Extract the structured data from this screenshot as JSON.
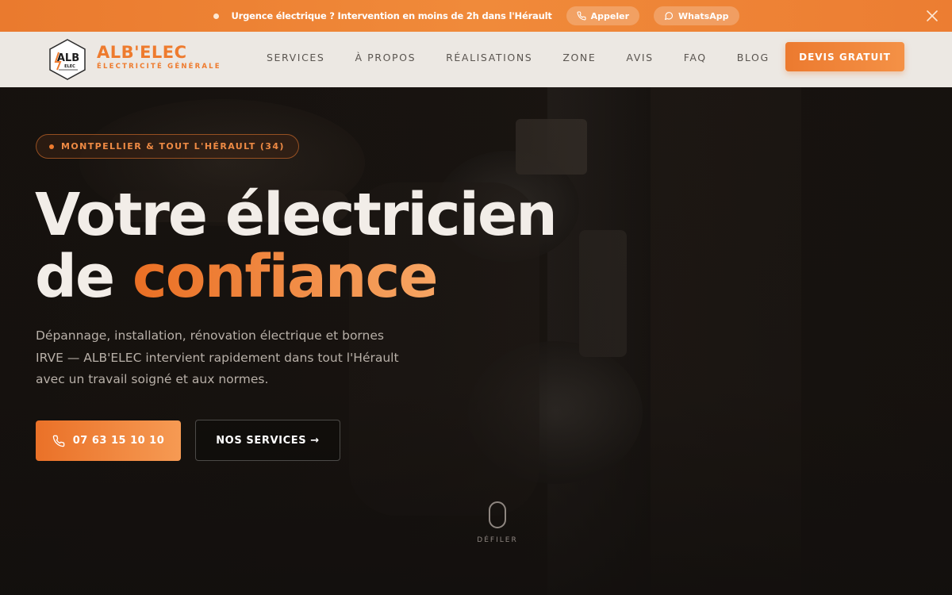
{
  "topbar": {
    "message_prefix": "Urgence électrique ? Intervention en ",
    "message_bold": "moins de 2h",
    "message_suffix": " dans l'Hérault",
    "call_label": "Appeler",
    "whatsapp_label": "WhatsApp"
  },
  "logo": {
    "mark_text": "ALB",
    "mark_sub": "ELEC"
  },
  "brand": {
    "name": "ALB'ELEC",
    "tagline": "ÉLECTRICITÉ GÉNÉRALE"
  },
  "nav": {
    "items": [
      "SERVICES",
      "À PROPOS",
      "RÉALISATIONS",
      "ZONE",
      "AVIS",
      "FAQ",
      "BLOG"
    ],
    "cta": "DEVIS GRATUIT"
  },
  "hero": {
    "location": "MONTPELLIER & TOUT L'HÉRAULT (34)",
    "title_line1": "Votre électricien",
    "title_line2_plain": "de ",
    "title_line2_accent": "confiance",
    "lead": "Dépannage, installation, rénovation électrique et bornes IRVE — ALB'ELEC intervient rapidement dans tout l'Hérault avec un travail soigné et aux normes.",
    "phone_button": "07 63 15 10 10",
    "services_button": "NOS SERVICES →",
    "scroll_label": "DÉFILER"
  },
  "colors": {
    "accent": "#ee7b2e",
    "nav_bg": "#ece8e3",
    "hero_bg": "#151210"
  }
}
